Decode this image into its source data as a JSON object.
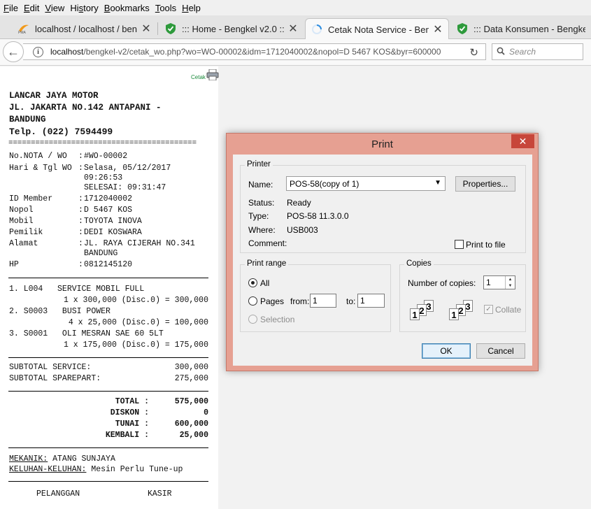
{
  "menu": [
    "File",
    "Edit",
    "View",
    "History",
    "Bookmarks",
    "Tools",
    "Help"
  ],
  "tabs": [
    {
      "label": "localhost / localhost / bengk",
      "icon": "phpmyadmin-icon"
    },
    {
      "label": "::: Home - Bengkel v2.0 :::",
      "icon": "shield-icon"
    },
    {
      "label": "Cetak Nota Service - Bengke",
      "icon": "loading-icon"
    },
    {
      "label": "::: Data Konsumen - Bengkel",
      "icon": "shield-icon"
    }
  ],
  "url": {
    "host": "localhost",
    "path": "/bengkel-v2/cetak_wo.php?wo=WO-00002&idm=1712040002&nopol=D 5467 KOS&byr=600000"
  },
  "search": {
    "placeholder": "Search"
  },
  "receipt": {
    "cetak_label": "Cetak",
    "shop_name": "LANCAR JAYA MOTOR",
    "address_1": "JL. JAKARTA NO.142 ANTAPANI -",
    "address_2": "BANDUNG",
    "phone": "Telp. (022) 7594499",
    "double_rule": "==========================================",
    "fields": [
      {
        "label": "No.NOTA / WO",
        "value": "#WO-00002"
      },
      {
        "label": "Hari & Tgl WO",
        "value": "Selasa, 05/12/2017"
      },
      {
        "label": "",
        "value": "09:26:53"
      },
      {
        "label": "",
        "value": "SELESAI: 09:31:47"
      },
      {
        "label": "ID Member",
        "value": "1712040002"
      },
      {
        "label": "Nopol",
        "value": "D 5467 KOS"
      },
      {
        "label": "Mobil",
        "value": "TOYOTA INOVA"
      },
      {
        "label": "Pemilik",
        "value": "DEDI KOSWARA"
      },
      {
        "label": "Alamat",
        "value": "JL. RAYA CIJERAH NO.341"
      },
      {
        "label": "",
        "value": "BANDUNG"
      },
      {
        "label": "HP",
        "value": "0812145120"
      }
    ],
    "items": [
      {
        "line1": "1. L004   SERVICE MOBIL FULL",
        "line2": "1 x 300,000 (Disc.0) = 300,000"
      },
      {
        "line1": "2. S0003   BUSI POWER",
        "line2": "4 x 25,000 (Disc.0) = 100,000"
      },
      {
        "line1": "3. S0001   OLI MESRAN SAE 60 5LT",
        "line2": "1 x 175,000 (Disc.0) = 175,000"
      }
    ],
    "subtotals": [
      {
        "label": "SUBTOTAL SERVICE:",
        "value": "300,000"
      },
      {
        "label": "SUBTOTAL SPAREPART:",
        "value": "275,000"
      }
    ],
    "totals": [
      {
        "label": "TOTAL :",
        "value": "575,000"
      },
      {
        "label": "DISKON :",
        "value": "0"
      },
      {
        "label": "TUNAI :",
        "value": "600,000"
      },
      {
        "label": "KEMBALI :",
        "value": "25,000"
      }
    ],
    "mekanik_label": "MEKANIK:",
    "mekanik_value": "ATANG SUNJAYA",
    "keluhan_label": "KELUHAN-KELUHAN:",
    "keluhan_value": "Mesin Perlu Tune-up",
    "sign_customer": "PELANGGAN",
    "sign_cashier": "KASIR"
  },
  "print_dialog": {
    "title": "Print",
    "printer_group": "Printer",
    "name_label": "Name:",
    "name_value": "POS-58(copy of 1)",
    "properties_button": "Properties...",
    "status_label": "Status:",
    "status_value": "Ready",
    "type_label": "Type:",
    "type_value": "POS-58 11.3.0.0",
    "where_label": "Where:",
    "where_value": "USB003",
    "comment_label": "Comment:",
    "print_to_file": "Print to file",
    "range_group": "Print range",
    "all_label": "All",
    "pages_label": "Pages",
    "from_label": "from:",
    "from_value": "1",
    "to_label": "to:",
    "to_value": "1",
    "selection_label": "Selection",
    "copies_group": "Copies",
    "copies_label": "Number of copies:",
    "copies_value": "1",
    "collate_label": "Collate",
    "collate_pages": [
      "1",
      "2",
      "3"
    ],
    "ok_button": "OK",
    "cancel_button": "Cancel"
  }
}
